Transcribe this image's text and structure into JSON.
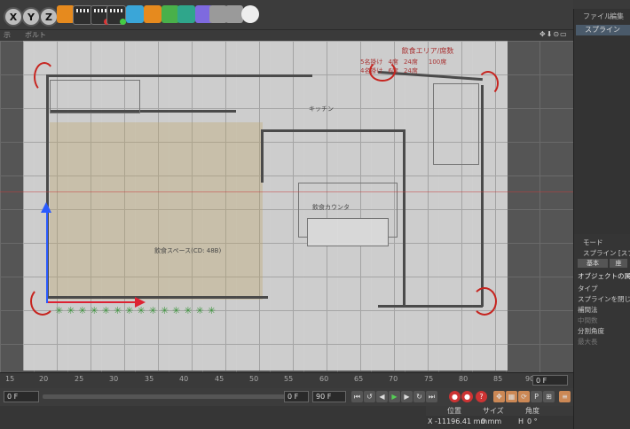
{
  "toolbar": {
    "axis_buttons": [
      "X",
      "Y",
      "Z"
    ]
  },
  "viewport": {
    "menu": [
      "示",
      "ボルト"
    ],
    "nav_icons": "✥⬇⊙▭"
  },
  "drawing": {
    "title": "飲食エリア/席数",
    "table_rows": [
      [
        "5名掛け",
        "4席",
        "24席"
      ],
      [
        "4名掛け",
        "6席",
        "24席"
      ]
    ],
    "total": "100席",
    "room_label": "飲食スペース(CD: 48B)",
    "kitchen_label": "キッチン",
    "bar_label": "飲食カウンタ"
  },
  "timeline": {
    "ticks": [
      "15",
      "20",
      "25",
      "30",
      "35",
      "40",
      "45",
      "50",
      "55",
      "60",
      "65",
      "70",
      "75",
      "80",
      "85",
      "90"
    ],
    "frame_field": "0 F"
  },
  "transport": {
    "field_left": "0 F",
    "field_start": "0 F",
    "field_end": "90 F"
  },
  "coords": {
    "headers": [
      "位置",
      "サイズ",
      "角度"
    ],
    "x_label": "X",
    "x_position": "-11196.41 mm",
    "x_size": "0 mm",
    "h_label": "H",
    "h_angle": "0 °"
  },
  "object_manager": {
    "menu": [
      "ファイル",
      "編集"
    ],
    "item": "スプライン"
  },
  "attributes": {
    "menu": "モード",
    "object": "スプライン [スプ",
    "tabs": [
      "基本",
      "座"
    ],
    "section": "オブジェクトの属性",
    "fields": [
      "タイプ",
      "スプラインを閉じる",
      "補間法",
      "中間数",
      "分割角度",
      "最大長"
    ]
  }
}
